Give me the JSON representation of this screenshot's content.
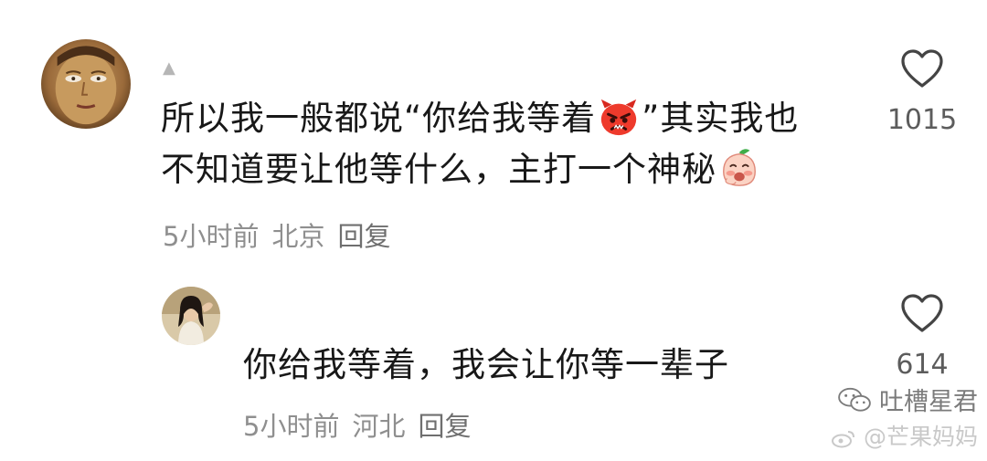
{
  "comments": [
    {
      "username": "▲",
      "text_line1_a": "所以我一般都说“你给我等着",
      "emoji_1": "angry-face-emoji",
      "text_line1_b": "”其实我也",
      "text_line2": "不知道要让他等什么，主打一个神秘",
      "emoji_2": "peach-face-emoji",
      "time": "5小时前",
      "location": "北京",
      "reply_label": "回复",
      "like_count": "1015"
    },
    {
      "text": "你给我等着，我会让你等一辈子",
      "time": "5小时前",
      "location": "河北",
      "reply_label": "回复",
      "like_count": "614"
    }
  ],
  "watermark": {
    "line1": "吐槽星君",
    "line2": "@芒果妈妈",
    "icon_1": "wechat-icon",
    "icon_2": "weibo-icon"
  },
  "colors": {
    "text": "#181818",
    "meta": "#8f8f8f",
    "like_count": "#5c5c5c",
    "heart_stroke": "#444444"
  }
}
